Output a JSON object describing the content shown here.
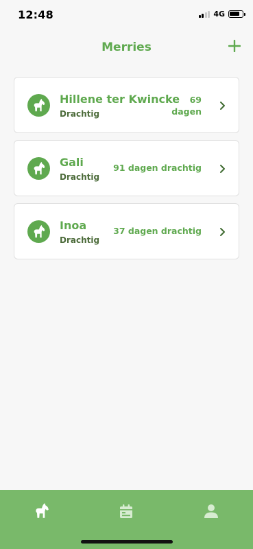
{
  "status_bar": {
    "time": "12:48",
    "network": "4G"
  },
  "header": {
    "title": "Merries"
  },
  "mares": [
    {
      "name": "Hillene ter Kwincke",
      "status": "Drachtig",
      "days": "69 dagen"
    },
    {
      "name": "Gali",
      "status": "Drachtig",
      "days": "91 dagen drachtig"
    },
    {
      "name": "Inoa",
      "status": "Drachtig",
      "days": "37 dagen drachtig"
    }
  ],
  "tab_bar": {
    "tabs": [
      "horse-icon",
      "calendar-icon",
      "user-icon"
    ]
  },
  "colors": {
    "accent": "#5fa94f",
    "status_text": "#4c6b3a",
    "tab_bar": "#79b96a",
    "background": "#f7f7f7"
  }
}
